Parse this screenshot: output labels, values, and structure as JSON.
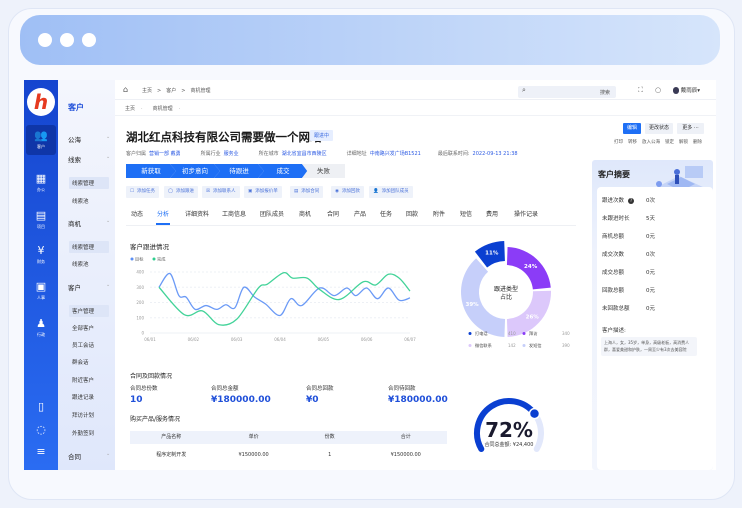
{
  "colors": {
    "accent": "#1e6ff5",
    "sidebar": "#1545cf",
    "target_line": "#5b8ff5",
    "done_line": "#2fce8e"
  },
  "sidebar": {
    "logo_letter": "h",
    "items": [
      {
        "icon": "users-icon",
        "glyph": "👥",
        "label": "客户"
      },
      {
        "icon": "office-icon",
        "glyph": "▦",
        "label": "办公"
      },
      {
        "icon": "project-icon",
        "glyph": "▤",
        "label": "项目"
      },
      {
        "icon": "money-bag-icon",
        "glyph": "¥",
        "label": "财务"
      },
      {
        "icon": "id-card-icon",
        "glyph": "▣",
        "label": "人事"
      },
      {
        "icon": "stamp-icon",
        "glyph": "♟",
        "label": "行政"
      }
    ],
    "bottom_icons": [
      {
        "icon": "document-icon",
        "glyph": "▯"
      },
      {
        "icon": "chat-icon",
        "glyph": "◌"
      },
      {
        "icon": "menu-icon",
        "glyph": "≡"
      }
    ]
  },
  "subnav": {
    "title": "客户",
    "items": [
      {
        "label": "公海",
        "type": "group"
      },
      {
        "label": "线索",
        "type": "group"
      },
      {
        "label": "线索管理",
        "type": "hl"
      },
      {
        "label": "线索池",
        "type": "item"
      },
      {
        "label": "商机",
        "type": "group"
      },
      {
        "label": "线索管理",
        "type": "hl"
      },
      {
        "label": "线索池",
        "type": "item"
      },
      {
        "label": "客户",
        "type": "group"
      },
      {
        "label": "客户管理",
        "type": "hl"
      },
      {
        "label": "全部客户",
        "type": "item"
      },
      {
        "label": "员工会话",
        "type": "item"
      },
      {
        "label": "群会话",
        "type": "item"
      },
      {
        "label": "附近客户",
        "type": "item"
      },
      {
        "label": "跟进记录",
        "type": "item"
      },
      {
        "label": "拜访计划",
        "type": "item"
      },
      {
        "label": "外勤签到",
        "type": "item"
      },
      {
        "label": "合同",
        "type": "group"
      }
    ]
  },
  "topbar": {
    "breadcrumb": [
      "主页",
      "客户",
      "商机管理"
    ],
    "search_button": "搜索",
    "user_name": "戴雨辰"
  },
  "breadcrumb2": [
    "主页",
    "商机管理"
  ],
  "header": {
    "title": "湖北红点科技有限公司需要做一个网站",
    "status": "跟进中",
    "info": [
      {
        "k": "客户归属",
        "v": "营销一部 戴勇"
      },
      {
        "k": "所属行业",
        "v": "服务业"
      },
      {
        "k": "所在城市",
        "v": "湖北省宜昌市西陵区"
      },
      {
        "k": "详细地址",
        "v": "中南路兴发广场B1521"
      },
      {
        "k": "最后联系时间:",
        "v": "2022-09-13 21:38"
      }
    ]
  },
  "pipeline": {
    "stages": [
      "新获取",
      "初步意向",
      "待跟进",
      "成交"
    ],
    "lost": "失败"
  },
  "actions": [
    "添加任务",
    "添加跟进",
    "添加联系人",
    "添加报价单",
    "添加合同",
    "添加回款",
    "添加团队成员"
  ],
  "tabs": [
    "动态",
    "分析",
    "详细资料",
    "工商信息",
    "团队成员",
    "商机",
    "合同",
    "产品",
    "任务",
    "回款",
    "附件",
    "短信",
    "费用",
    "操作记录"
  ],
  "active_tab": "分析",
  "chart_data": [
    {
      "type": "line",
      "title": "客户跟进情况",
      "ylim": [
        0,
        400
      ],
      "yticks": [
        0,
        100,
        200,
        300,
        400
      ],
      "xticks": [
        "06/01",
        "06/02",
        "06/03",
        "06/04",
        "06/05",
        "06/06",
        "06/07"
      ],
      "grid": true,
      "legend": "top-left",
      "series": [
        {
          "name": "目标",
          "color": "#5b8ff5",
          "points": [
            [
              "06/01 05:00",
              300
            ],
            [
              "06/01 11:00",
              390
            ],
            [
              "06/01 16:00",
              245
            ],
            [
              "06/01 20:00",
              235
            ],
            [
              "06/02 01:00",
              155
            ],
            [
              "06/02 07:00",
              180
            ],
            [
              "06/02 13:00",
              155
            ],
            [
              "06/02 18:00",
              185
            ],
            [
              "06/02 23:00",
              165
            ],
            [
              "06/03 04:00",
              300
            ],
            [
              "06/03 10:00",
              235
            ],
            [
              "06/03 16:00",
              190
            ],
            [
              "06/04 00:00",
              115
            ],
            [
              "06/04 06:00",
              225
            ],
            [
              "06/04 12:00",
              180
            ],
            [
              "06/04 22:00",
              295
            ],
            [
              "06/05 06:00",
              245
            ],
            [
              "06/05 13:00",
              295
            ],
            [
              "06/05 18:00",
              245
            ],
            [
              "06/06 00:00",
              295
            ],
            [
              "06/06 06:00",
              225
            ],
            [
              "06/06 12:00",
              295
            ],
            [
              "06/06 18:00",
              215
            ],
            [
              "06/07 00:00",
              230
            ]
          ]
        },
        {
          "name": "完成",
          "color": "#2fce8e",
          "points": [
            [
              "06/01 05:00",
              300
            ],
            [
              "06/01 19:00",
              120
            ],
            [
              "06/02 05:00",
              145
            ],
            [
              "06/02 14:00",
              55
            ],
            [
              "06/03 00:00",
              90
            ],
            [
              "06/03 12:00",
              295
            ],
            [
              "06/03 17:00",
              320
            ],
            [
              "06/04 02:00",
              395
            ],
            [
              "06/04 07:00",
              360
            ],
            [
              "06/04 15:00",
              360
            ],
            [
              "06/04 22:00",
              285
            ],
            [
              "06/05 09:00",
              220
            ],
            [
              "06/05 22:00",
              335
            ],
            [
              "06/06 05:00",
              315
            ],
            [
              "06/06 12:00",
              385
            ],
            [
              "06/06 18:00",
              360
            ],
            [
              "06/07 00:00",
              275
            ]
          ]
        }
      ]
    },
    {
      "type": "pie",
      "title": "跟进类型占比",
      "slices": [
        {
          "name": "拜访",
          "pct": 24,
          "count": 340,
          "color": "#8b3cf7"
        },
        {
          "name": "微信联系",
          "pct": 26,
          "count": 142,
          "color": "#dcc8fb"
        },
        {
          "name": "发短信",
          "pct": 39,
          "count": 390,
          "color": "#c6cffa"
        },
        {
          "name": "打电话",
          "pct": 11,
          "count": 410,
          "color": "#0a3fd1"
        }
      ],
      "legend_order": [
        "打电话",
        "拜访",
        "微信联系",
        "发短信"
      ]
    }
  ],
  "contract": {
    "title": "合同及回款情况",
    "stats": [
      {
        "label": "合同总份数",
        "value": "10"
      },
      {
        "label": "合同总金额",
        "value": "¥180000.00"
      },
      {
        "label": "合同总回款",
        "value": "¥0"
      },
      {
        "label": "合同待回款",
        "value": "¥180000.00"
      }
    ]
  },
  "products": {
    "title": "购买产品/服务情况",
    "columns": [
      "产品名称",
      "单价",
      "份数",
      "合计"
    ],
    "rows": [
      [
        "程序定制开发",
        "¥150000.00",
        "1",
        "¥150000.00"
      ]
    ]
  },
  "gauge": {
    "percent": 72,
    "label": "72%",
    "caption": "合同总金额: ¥24,400",
    "color": "#0a3fd1"
  },
  "right": {
    "edit": "编辑",
    "change_status": "更改状态",
    "more": "更多",
    "more_icon": "···",
    "small_actions": [
      "打印",
      "转移",
      "放入公海",
      "锁定",
      "解锁",
      "删除"
    ],
    "summary_title": "客户摘要",
    "rows": [
      {
        "k": "跟进次数",
        "v": "0次",
        "help": true
      },
      {
        "k": "未跟进时长",
        "v": "5天"
      },
      {
        "k": "商机总额",
        "v": "0元"
      },
      {
        "k": "成交次数",
        "v": "0次"
      },
      {
        "k": "成交总额",
        "v": "0元"
      },
      {
        "k": "回款总额",
        "v": "0元"
      },
      {
        "k": "未回款总额",
        "v": "0元"
      }
    ],
    "desc_label": "客户描述:",
    "desc": "上海人，女，35岁，单身，高级老板，高消费人群，喜爱美甜和护肤，一周至少有3次去美容院"
  }
}
